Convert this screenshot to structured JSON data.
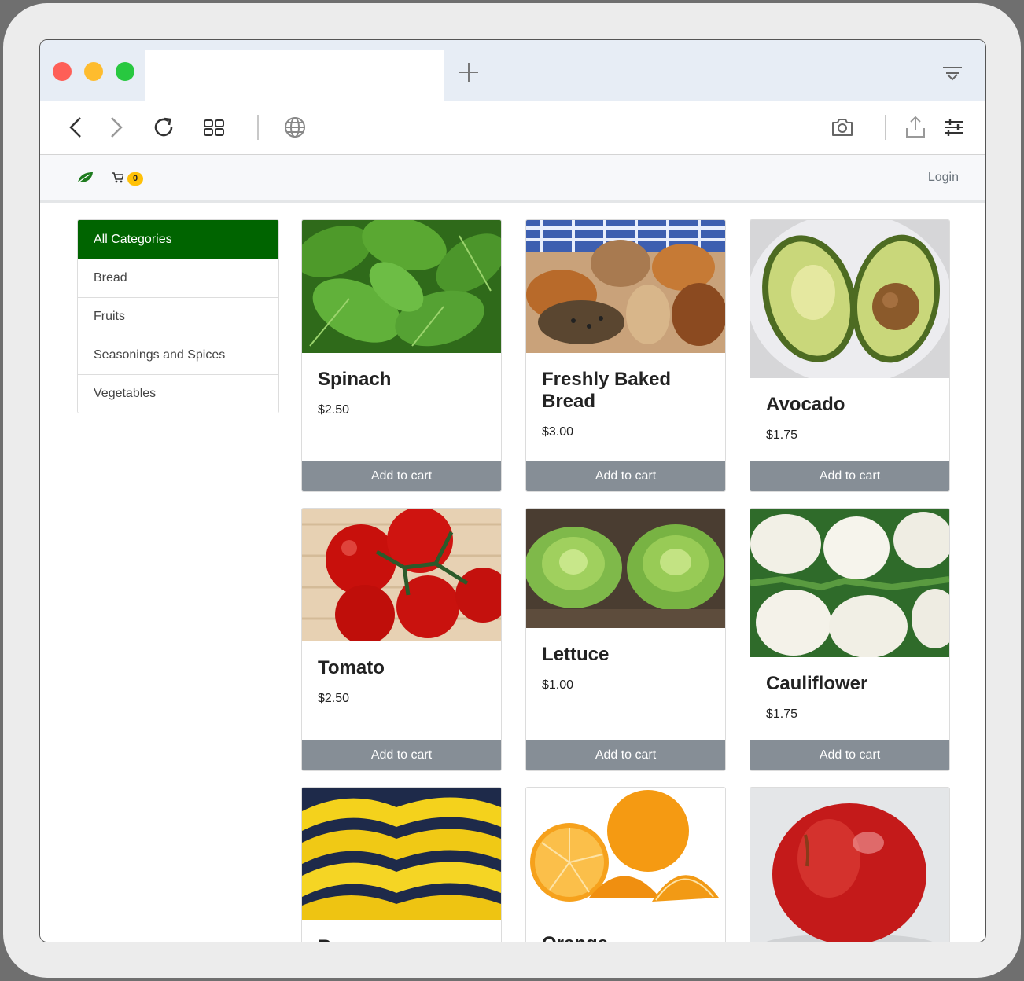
{
  "browser": {
    "tab_title": "",
    "window_controls": [
      "close",
      "minimize",
      "maximize"
    ]
  },
  "navbar": {
    "cart_count": "0",
    "login_label": "Login"
  },
  "categories": [
    {
      "label": "All Categories",
      "active": true
    },
    {
      "label": "Bread",
      "active": false
    },
    {
      "label": "Fruits",
      "active": false
    },
    {
      "label": "Seasonings and Spices",
      "active": false
    },
    {
      "label": "Vegetables",
      "active": false
    }
  ],
  "products": [
    {
      "name": "Spinach",
      "price": "$2.50",
      "button": "Add to cart",
      "image": "spinach-leaves"
    },
    {
      "name": "Freshly Baked Bread",
      "price": "$3.00",
      "button": "Add to cart",
      "image": "bread-rolls"
    },
    {
      "name": "Avocado",
      "price": "$1.75",
      "button": "Add to cart",
      "image": "avocado-halves"
    },
    {
      "name": "Tomato",
      "price": "$2.50",
      "button": "Add to cart",
      "image": "tomatoes-on-vine"
    },
    {
      "name": "Lettuce",
      "price": "$1.00",
      "button": "Add to cart",
      "image": "lettuce-heads"
    },
    {
      "name": "Cauliflower",
      "price": "$1.75",
      "button": "Add to cart",
      "image": "cauliflower-heads"
    },
    {
      "name": "B",
      "price": "",
      "button": "",
      "image": "bananas"
    },
    {
      "name": "Orange",
      "price": "",
      "button": "",
      "image": "orange-slices"
    },
    {
      "name": "",
      "price": "",
      "button": "",
      "image": "red-apple"
    }
  ],
  "colors": {
    "brand_green": "#006400",
    "button_gray": "#868e96",
    "badge_yellow": "#ffc107"
  }
}
